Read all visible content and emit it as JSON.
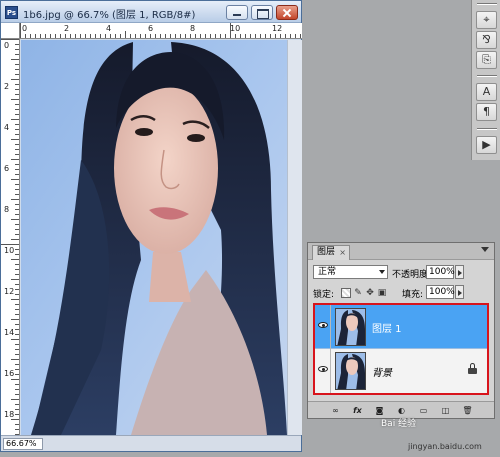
{
  "document": {
    "title": "1b6.jpg @ 66.7% (图层 1, RGB/8#)",
    "app_icon_label": "Ps",
    "zoom": "66.67%",
    "ruler_top_labels": [
      "0",
      "2",
      "4",
      "6",
      "8",
      "10",
      "12"
    ],
    "ruler_left_labels": [
      "0",
      "2",
      "4",
      "6",
      "8",
      "10",
      "12",
      "14",
      "16",
      "18"
    ]
  },
  "dock": {
    "buttons": [
      "history-brush",
      "channel-mixer",
      "clone-source",
      "character",
      "paragraph",
      "actions"
    ]
  },
  "layers_panel": {
    "tab_label": "图层",
    "tab_close": "×",
    "blend_mode": "正常",
    "opacity_label": "不透明度:",
    "opacity_value": "100%",
    "lock_label": "锁定:",
    "fill_label": "填充:",
    "fill_value": "100%",
    "layers": [
      {
        "name": "图层 1",
        "selected": true,
        "visible": true,
        "locked": false
      },
      {
        "name": "背景",
        "selected": false,
        "visible": true,
        "locked": true
      }
    ],
    "bottom_buttons": [
      "link-layers",
      "fx",
      "add-mask",
      "adjustment-layer",
      "new-group",
      "new-layer",
      "delete-layer"
    ],
    "highlight_color": "#d8141c",
    "selection_color": "#4aa3f3"
  },
  "watermark": {
    "text": "Bai 经验",
    "url": "jingyan.baidu.com"
  }
}
